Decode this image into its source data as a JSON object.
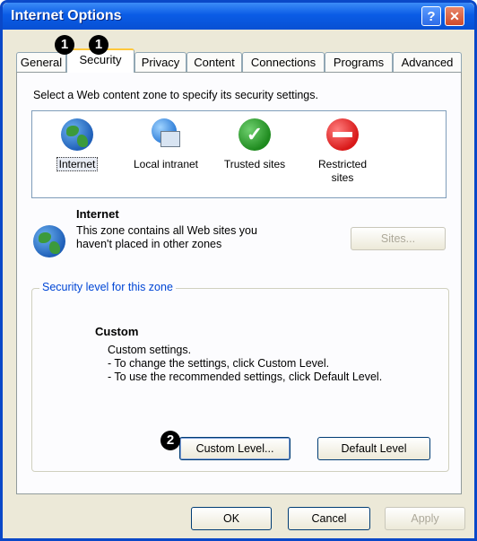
{
  "window": {
    "title": "Internet Options",
    "help_glyph": "?",
    "close_glyph": "✕"
  },
  "tabs": [
    {
      "label": "General"
    },
    {
      "label": "Security",
      "active": true
    },
    {
      "label": "Privacy"
    },
    {
      "label": "Content"
    },
    {
      "label": "Connections"
    },
    {
      "label": "Programs"
    },
    {
      "label": "Advanced"
    }
  ],
  "security": {
    "zone_prompt": "Select a Web content zone to specify its security settings.",
    "zones": [
      {
        "label": "Internet",
        "icon": "globe-icon",
        "selected": true
      },
      {
        "label": "Local intranet",
        "icon": "intranet-icon"
      },
      {
        "label": "Trusted sites",
        "icon": "checkmark-icon",
        "glyph": "✓"
      },
      {
        "label": "Restricted",
        "label2": "sites",
        "icon": "no-entry-icon"
      }
    ],
    "selected_zone_name": "Internet",
    "selected_zone_desc_line1": "This zone contains all Web sites you",
    "selected_zone_desc_line2": "haven't placed in other zones",
    "sites_button": "Sites...",
    "level_group_title": "Security level for this zone",
    "level_name": "Custom",
    "level_desc": [
      "Custom settings.",
      "- To change the settings, click Custom Level.",
      "- To use the recommended settings, click Default Level."
    ],
    "custom_level_button": "Custom Level...",
    "default_level_button": "Default Level"
  },
  "footer": {
    "ok": "OK",
    "cancel": "Cancel",
    "apply": "Apply"
  },
  "callouts": [
    "1",
    "1",
    "2"
  ]
}
